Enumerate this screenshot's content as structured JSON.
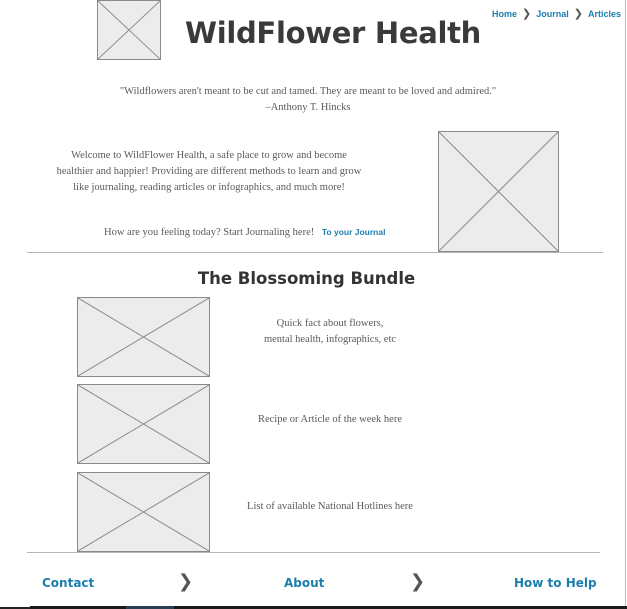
{
  "header": {
    "title": "WildFlower Health",
    "logo_icon": "image-placeholder-icon"
  },
  "breadcrumb": {
    "items": [
      "Home",
      "Journal",
      "Articles"
    ],
    "separator_icon": "chevron-right-icon"
  },
  "quote": {
    "text": "\"Wildflowers aren't meant to be cut and tamed. They are meant to be loved and admired.\"",
    "author": "–Anthony T. Hincks"
  },
  "intro": {
    "welcome": "Welcome to WildFlower Health, a safe place to grow and become healthier and happier! Providing are different methods to learn and grow like journaling, reading articles or infographics, and much more!",
    "cta_text": "How are you feeling today? Start Journaling here!",
    "cta_link": "To your Journal"
  },
  "bundle": {
    "title": "The Blossoming Bundle",
    "items": [
      {
        "text": "Quick fact about flowers,\nmental health, infographics, etc"
      },
      {
        "text": "Recipe or Article of the week here"
      },
      {
        "text": "List of available National Hotlines here"
      }
    ]
  },
  "footer": {
    "links": [
      "Contact",
      "About",
      "How to Help"
    ],
    "separator_icon": "chevron-right-icon"
  },
  "colors": {
    "link": "#1b7fae",
    "text": "#5a5a5a",
    "placeholder_fill": "#ececec",
    "placeholder_stroke": "#8a8a8a"
  }
}
